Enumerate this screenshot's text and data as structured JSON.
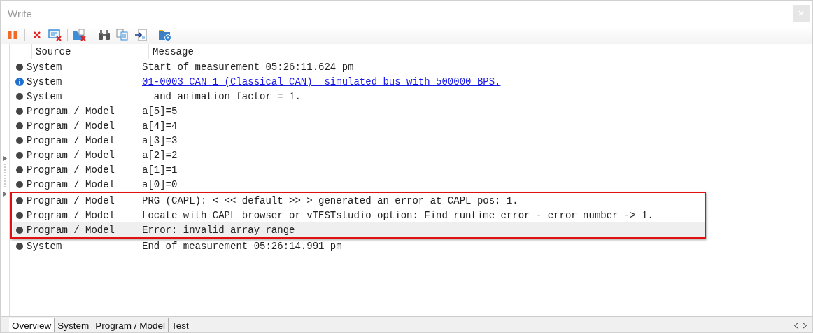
{
  "window": {
    "title": "Write"
  },
  "table": {
    "columns": [
      "Source",
      "Message"
    ],
    "rows": [
      {
        "kind": "dot",
        "source": "System",
        "message": "Start of measurement 05:26:11.624 pm",
        "link": false,
        "marked": false,
        "selected": false
      },
      {
        "kind": "info",
        "source": "System",
        "message": "01-0003 CAN 1 (Classical CAN)  simulated bus with 500000 BPS.",
        "link": true,
        "marked": false,
        "selected": false
      },
      {
        "kind": "dot",
        "source": "System",
        "message": "  and animation factor = 1.",
        "link": false,
        "marked": false,
        "selected": false
      },
      {
        "kind": "dot",
        "source": "Program / Model",
        "message": "a[5]=5",
        "link": false,
        "marked": false,
        "selected": false
      },
      {
        "kind": "dot",
        "source": "Program / Model",
        "message": "a[4]=4",
        "link": false,
        "marked": false,
        "selected": false
      },
      {
        "kind": "dot",
        "source": "Program / Model",
        "message": "a[3]=3",
        "link": false,
        "marked": false,
        "selected": false
      },
      {
        "kind": "dot",
        "source": "Program / Model",
        "message": "a[2]=2",
        "link": false,
        "marked": false,
        "selected": false
      },
      {
        "kind": "dot",
        "source": "Program / Model",
        "message": "a[1]=1",
        "link": false,
        "marked": false,
        "selected": false
      },
      {
        "kind": "dot",
        "source": "Program / Model",
        "message": "a[0]=0",
        "link": false,
        "marked": false,
        "selected": false
      },
      {
        "kind": "dot",
        "source": "Program / Model",
        "message": "PRG (CAPL): < << default >> > generated an error at CAPL pos: 1.",
        "link": false,
        "marked": true,
        "selected": false
      },
      {
        "kind": "dot",
        "source": "Program / Model",
        "message": "Locate with CAPL browser or vTESTstudio option: Find runtime error - error number -> 1.",
        "link": false,
        "marked": true,
        "selected": false
      },
      {
        "kind": "dot",
        "source": "Program / Model",
        "message": "Error: invalid array range",
        "link": false,
        "marked": true,
        "selected": true
      },
      {
        "kind": "dot",
        "source": "System",
        "message": "End of measurement 05:26:14.991 pm",
        "link": false,
        "marked": false,
        "selected": false
      }
    ]
  },
  "tabs": [
    {
      "label": "Overview",
      "selected": true
    },
    {
      "label": "System",
      "selected": false
    },
    {
      "label": "Program / Model",
      "selected": false
    },
    {
      "label": "Test",
      "selected": false
    }
  ]
}
